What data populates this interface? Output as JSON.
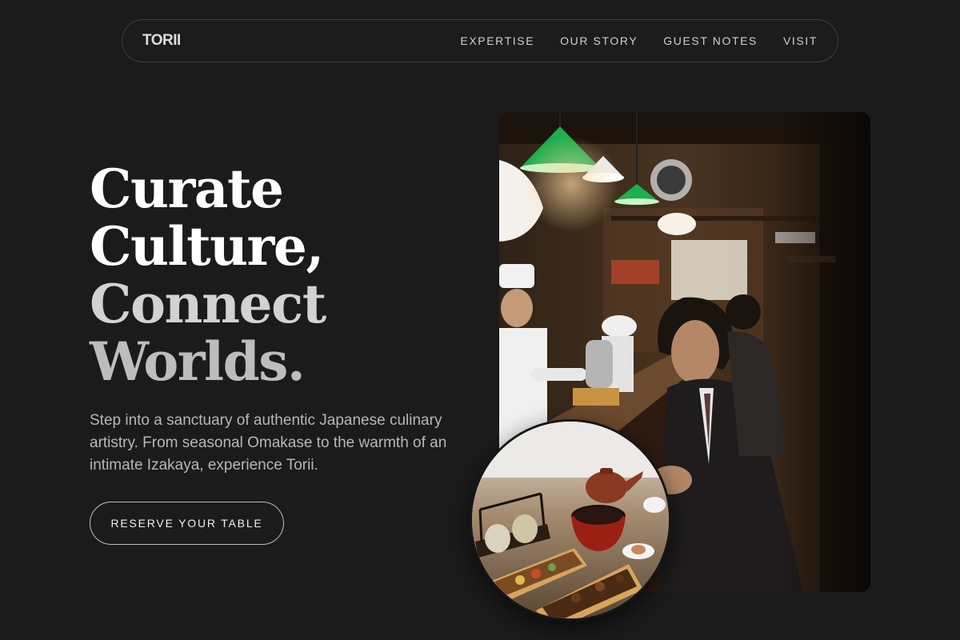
{
  "nav": {
    "logo": "TORII",
    "links": [
      "EXPERTISE",
      "OUR STORY",
      "GUEST NOTES",
      "VISIT"
    ]
  },
  "hero": {
    "headline": [
      "Curate",
      "Culture,",
      "Connect",
      "Worlds."
    ],
    "lead": "Step into a sanctuary of authentic Japanese culinary artistry. From seasonal Omakase to the warmth of an intimate Izakaya, experience Torii.",
    "cta_label": "RESERVE YOUR TABLE"
  },
  "images": {
    "main": "izakaya-counter-photo",
    "round": "bento-tea-set-photo"
  },
  "colors": {
    "background": "#1b1b1b",
    "text_primary": "#ffffff",
    "text_muted": "#b7b7b7",
    "lamp_green": "#1fae4e"
  }
}
